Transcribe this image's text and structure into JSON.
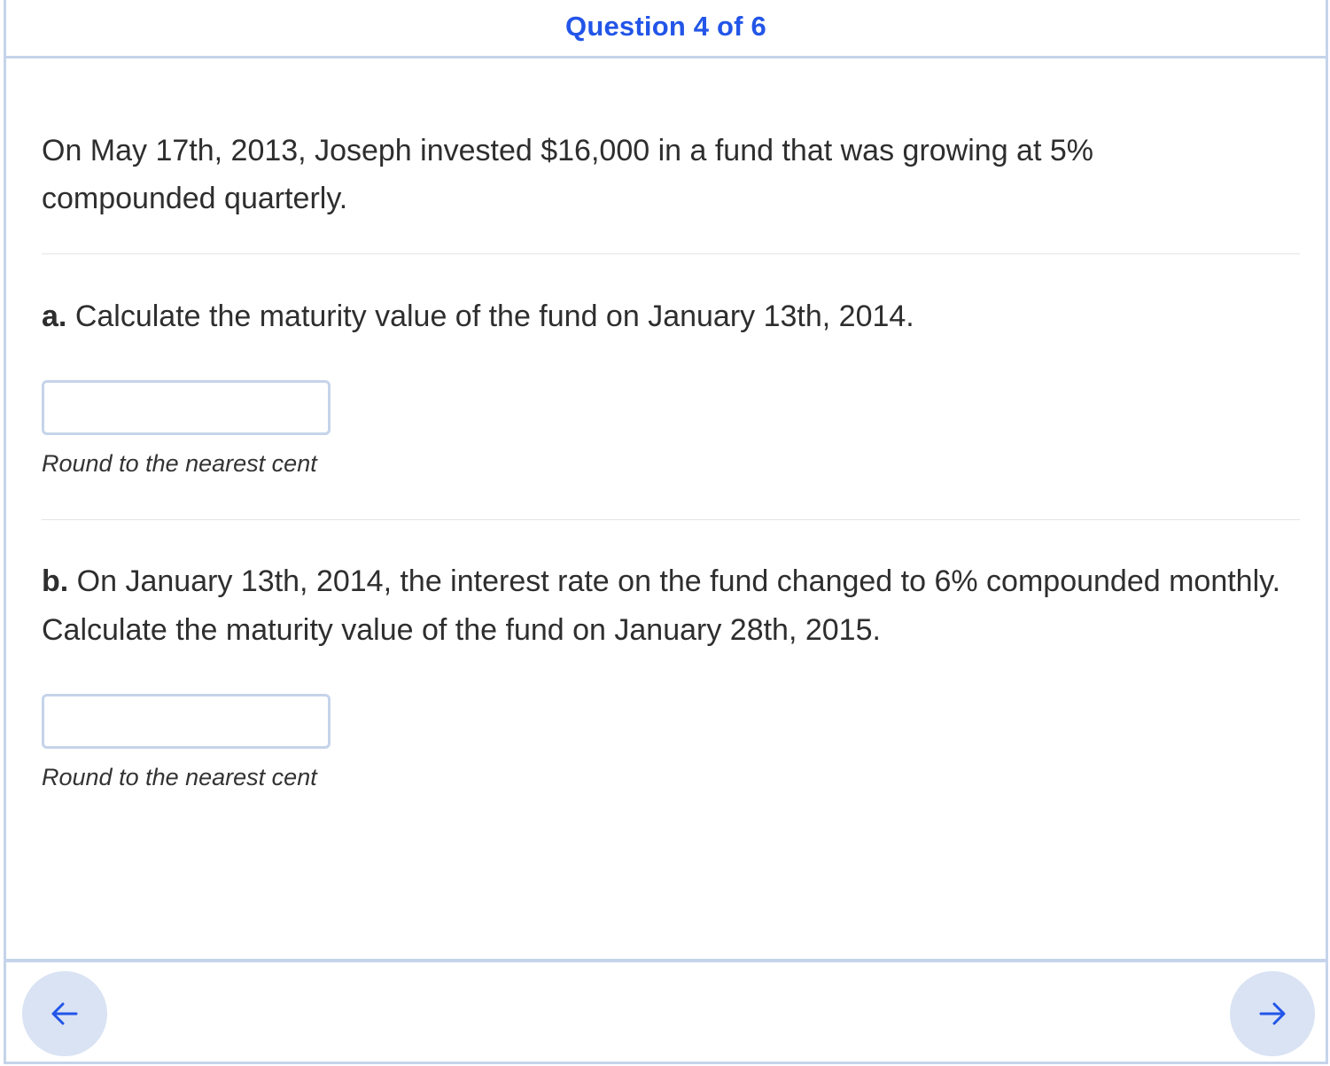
{
  "header": {
    "title": "Question 4 of 6"
  },
  "question": {
    "stem": "On May 17th, 2013, Joseph invested $16,000 in a fund that was growing at 5% compounded quarterly.",
    "parts": [
      {
        "label": "a.",
        "text": "Calculate the maturity value of the fund on January 13th, 2014.",
        "answer_value": "",
        "hint": "Round to the nearest cent"
      },
      {
        "label": "b.",
        "text": "On January 13th, 2014, the interest rate on the fund changed to 6% compounded monthly. Calculate the maturity value of the fund on January 28th, 2015.",
        "answer_value": "",
        "hint": "Round to the nearest cent"
      }
    ]
  },
  "navigation": {
    "prev_icon": "arrow-left-icon",
    "next_icon": "arrow-right-icon"
  },
  "colors": {
    "accent": "#2255e8",
    "border": "#c5d4ea",
    "nav_button_bg": "#d9e3f3"
  }
}
